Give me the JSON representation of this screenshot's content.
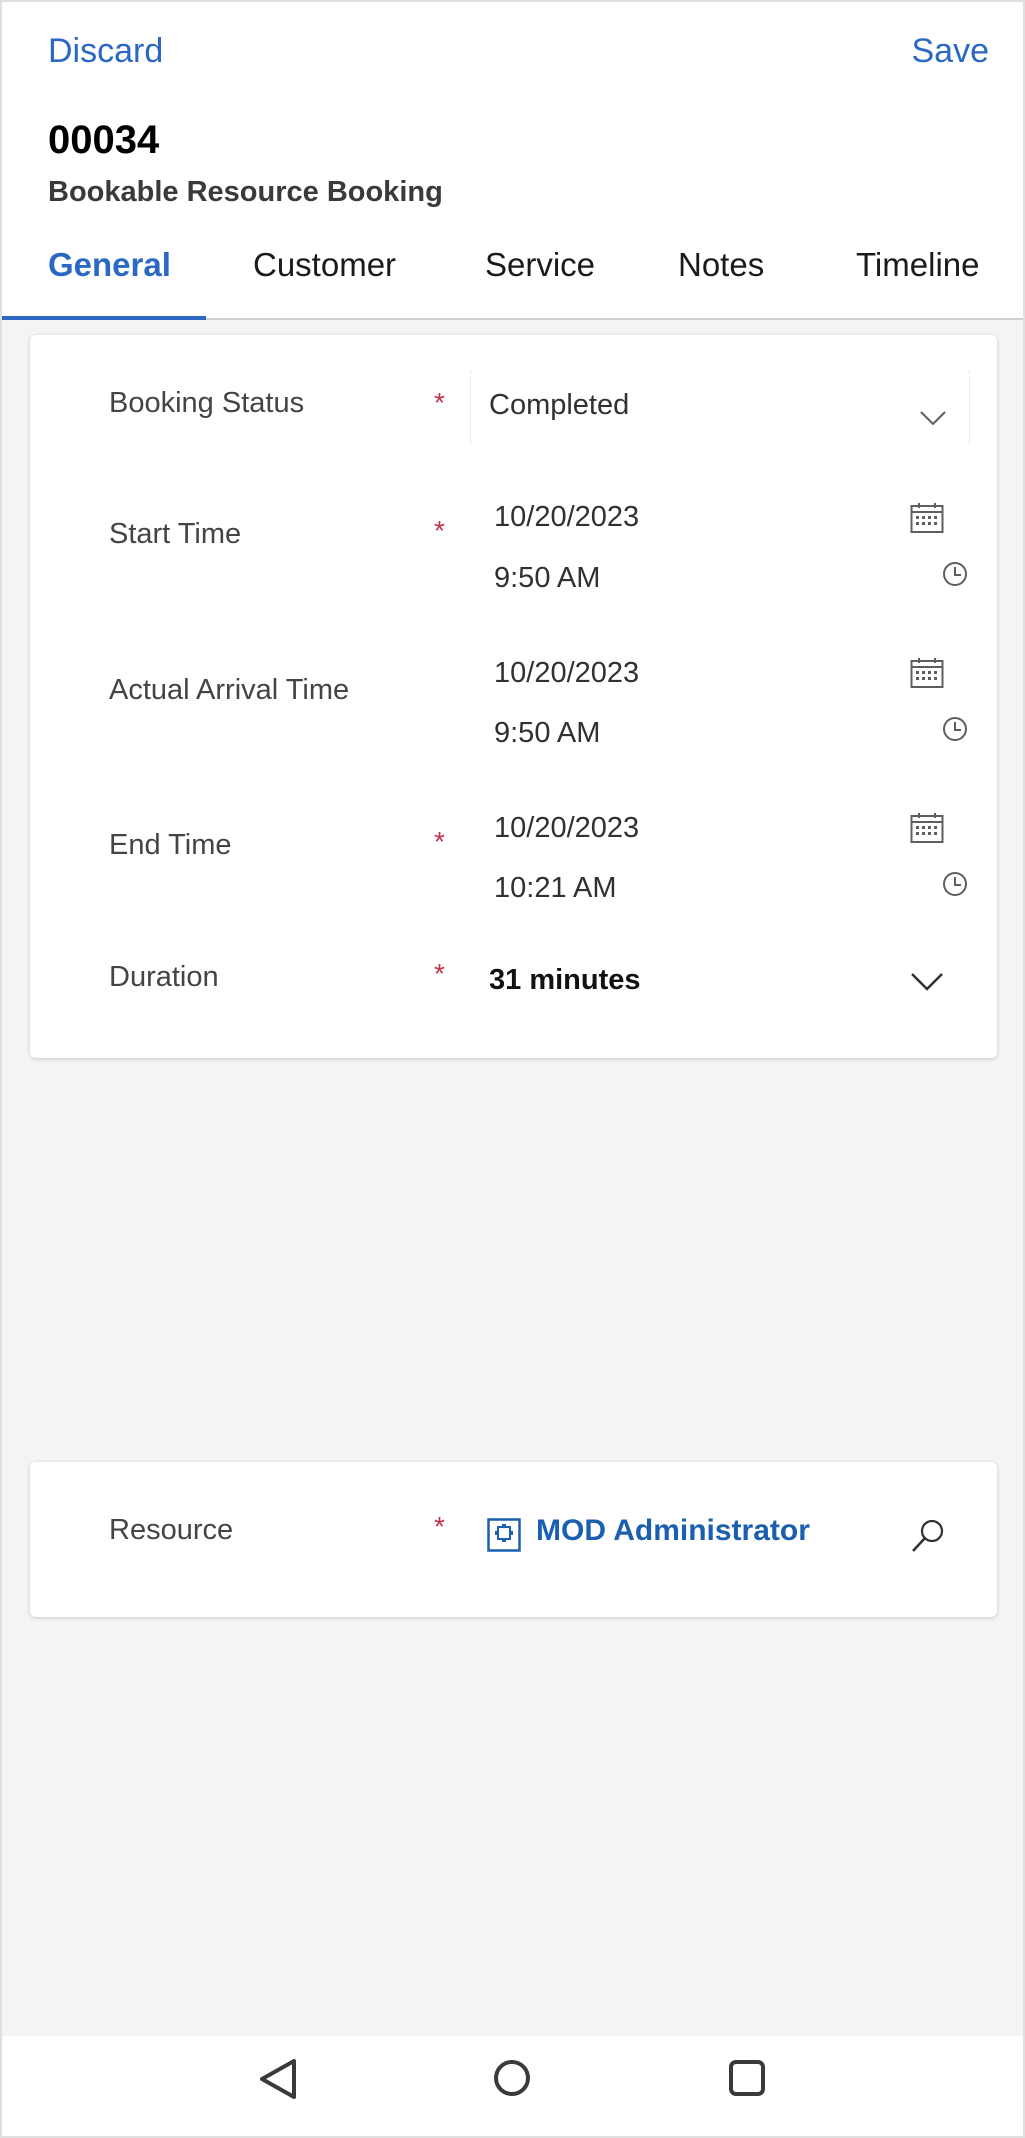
{
  "commands": {
    "discard": "Discard",
    "save": "Save"
  },
  "record": {
    "title": "00034",
    "subtitle": "Bookable Resource Booking"
  },
  "tabs": [
    "General",
    "Customer",
    "Service",
    "Notes",
    "Timeline"
  ],
  "active_tab": "General",
  "accent_color": "#2b68c4",
  "required_color": "#c4314b",
  "fields": {
    "booking_status": {
      "label": "Booking Status",
      "required": "*",
      "value": "Completed"
    },
    "start_time": {
      "label": "Start Time",
      "required": "*",
      "date": "10/20/2023",
      "time": "9:50 AM"
    },
    "actual_arrival_time": {
      "label": "Actual Arrival Time",
      "date": "10/20/2023",
      "time": "9:50 AM"
    },
    "end_time": {
      "label": "End Time",
      "required": "*",
      "date": "10/20/2023",
      "time": "10:21 AM"
    },
    "duration": {
      "label": "Duration",
      "required": "*",
      "value": "31 minutes"
    },
    "resource": {
      "label": "Resource",
      "required": "*",
      "value": "MOD Administrator"
    }
  },
  "icons": {
    "calendar": "calendar-icon",
    "clock": "clock-icon",
    "chevron": "chevron-down-icon",
    "search": "search-icon",
    "resource": "resource-entity-icon",
    "nav_back": "back-triangle-icon",
    "nav_home": "home-circle-icon",
    "nav_recent": "recent-square-icon"
  }
}
